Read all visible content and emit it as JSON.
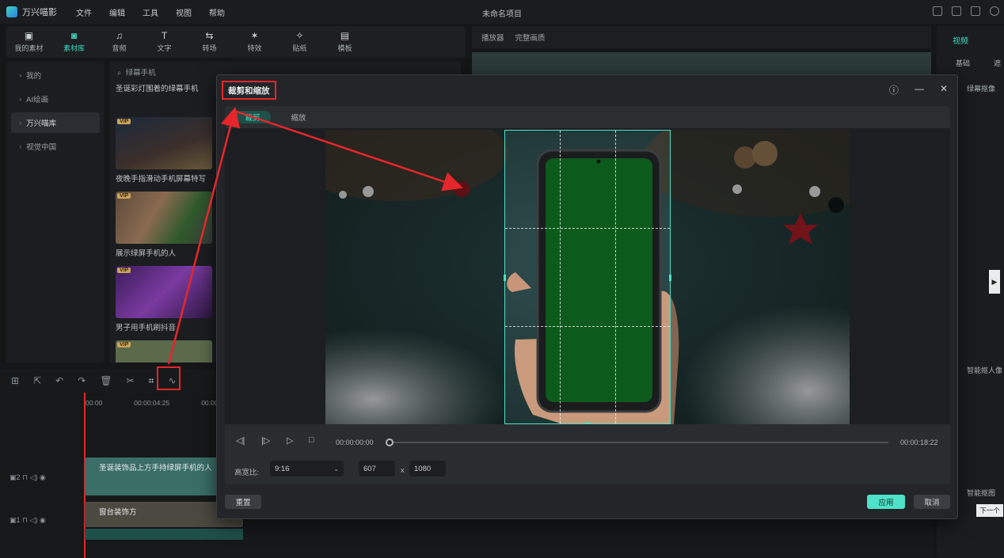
{
  "app": {
    "name": "万兴喵影",
    "menu": [
      "文件",
      "编辑",
      "工具",
      "视图",
      "帮助"
    ],
    "project_title": "未命名项目"
  },
  "toolbar": [
    "我的素材",
    "素材库",
    "音频",
    "文字",
    "转场",
    "特效",
    "贴纸",
    "模板"
  ],
  "toolbar_icons": [
    "picture-icon",
    "library-icon",
    "music-note-icon",
    "text-icon",
    "transition-icon",
    "effects-icon",
    "sticker-icon",
    "template-icon"
  ],
  "leftnav": [
    "我的",
    "AI绘画",
    "万兴喵库",
    "视觉中国"
  ],
  "media": {
    "search_placeholder": "绿幕手机",
    "items": [
      {
        "label": "圣诞彩灯围着的绿幕手机",
        "vip": ""
      },
      {
        "label": "夜晚手指滑动手机屏幕特写",
        "vip": "VIP"
      },
      {
        "label": "展示绿屏手机的人",
        "vip": "VIP"
      },
      {
        "label": "男子用手机刷抖音",
        "vip": "VIP"
      },
      {
        "label": "",
        "vip": "VIP"
      }
    ]
  },
  "preview": {
    "player": "播放器",
    "quality": "完整画质"
  },
  "rightpanel": {
    "tabs": [
      "视频"
    ],
    "subtabs": [
      "基础",
      "遮"
    ],
    "items": [
      "绿幕抠像",
      "智能抠人像",
      "智能抠图"
    ]
  },
  "timeline": {
    "ticks": [
      "00:00",
      "00:00:04:25",
      "00:00:0"
    ],
    "clip1": "圣诞装饰品上方手持绿屏手机的人",
    "clip2": "窗台装饰方"
  },
  "dialog": {
    "title": "裁剪和缩放",
    "tabs": [
      "裁剪",
      "缩放"
    ],
    "time_current": "00:00:00:00",
    "time_total": "00:00:18:22",
    "ratio_label": "高宽比:",
    "ratio_value": "9:16",
    "width": "607",
    "x": "x",
    "height": "1080",
    "reset": "重置",
    "apply": "应用",
    "cancel": "取消"
  },
  "next_tooltip": "下一个",
  "colors": {
    "accent": "#3fd6c0",
    "annotation": "#e5262b",
    "green_screen": "#0d5b1c"
  }
}
